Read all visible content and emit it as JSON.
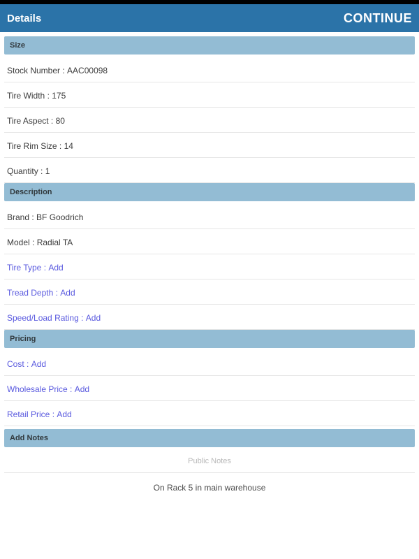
{
  "header": {
    "title": "Details",
    "continue": "CONTINUE"
  },
  "sections": {
    "size": {
      "title": "Size",
      "rows": [
        {
          "label": "Stock Number",
          "value": "AAC00098",
          "link": false
        },
        {
          "label": "Tire Width",
          "value": "175",
          "link": false
        },
        {
          "label": "Tire Aspect",
          "value": "80",
          "link": false
        },
        {
          "label": "Tire Rim Size",
          "value": "14",
          "link": false
        },
        {
          "label": "Quantity",
          "value": "1",
          "link": false
        }
      ]
    },
    "description": {
      "title": "Description",
      "rows": [
        {
          "label": "Brand",
          "value": "BF Goodrich",
          "link": false
        },
        {
          "label": "Model",
          "value": "Radial TA",
          "link": false
        },
        {
          "label": "Tire Type",
          "value": "Add",
          "link": true
        },
        {
          "label": "Tread Depth",
          "value": "Add",
          "link": true
        },
        {
          "label": "Speed/Load Rating",
          "value": "Add",
          "link": true
        }
      ]
    },
    "pricing": {
      "title": "Pricing",
      "rows": [
        {
          "label": "Cost",
          "value": "Add",
          "link": true
        },
        {
          "label": "Wholesale Price",
          "value": "Add",
          "link": true
        },
        {
          "label": "Retail Price",
          "value": "Add",
          "link": true
        }
      ]
    },
    "notes": {
      "title": "Add Notes",
      "subtitle": "Public Notes",
      "text": "On Rack 5 in main warehouse"
    }
  }
}
